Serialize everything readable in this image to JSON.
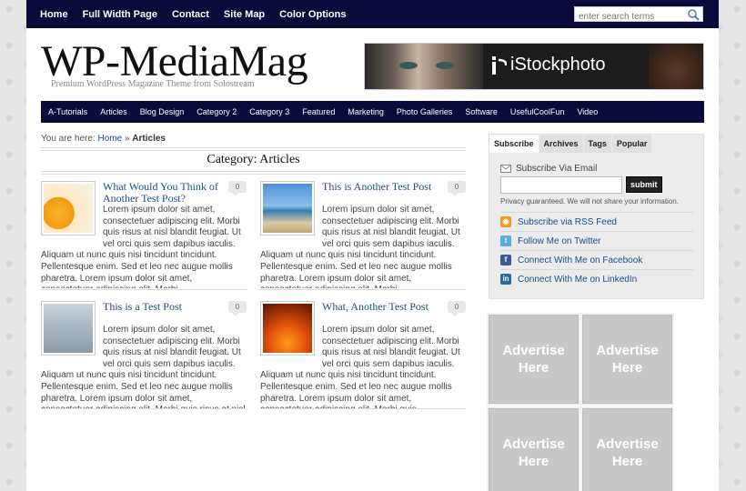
{
  "topnav": {
    "links": [
      "Home",
      "Full Width Page",
      "Contact",
      "Site Map",
      "Color Options"
    ],
    "search_placeholder": "enter search terms"
  },
  "header": {
    "logo": "WP-MediaMag",
    "tagline": "Premium WordPress Magazine Theme from Solostream",
    "banner_brand": "iStockphoto"
  },
  "catnav": [
    "A-Tutorials",
    "Articles",
    "Blog Design",
    "Category 2",
    "Category 3",
    "Featured",
    "Marketing",
    "Photo Galleries",
    "Software",
    "UsefulCoolFun",
    "Video"
  ],
  "breadcrumb": {
    "prefix": "You are here:",
    "home": "Home",
    "sep": "»",
    "current": "Articles"
  },
  "category_title": "Category: Articles",
  "posts": [
    {
      "title": "What Would You Think of Another Test Post?",
      "comments": "0",
      "excerpt": "Lorem ipsum dolor sit amet, consectetuer adipiscing elit. Morbi quis risus at nisl blandit feugiat. Ut vel orci quis sem dapibus iaculis. Aliquam ut nunc quis nisi tincidunt tincidunt. Pellentesque enim. Sed et leo nec augue mollis pharetra. Lorem ipsum dolor sit amet, consectetuer adipiscing elit. Morbi"
    },
    {
      "title": "This is Another Test Post",
      "comments": "0",
      "excerpt": "Lorem ipsum dolor sit amet, consectetuer adipiscing elit. Morbi quis risus at nisl blandit feugiat. Ut vel orci quis sem dapibus iaculis. Aliquam ut nunc quis nisi tincidunt tincidunt. Pellentesque enim. Sed et leo nec augue mollis pharetra. Lorem ipsum dolor sit amet, consectetuer adipiscing elit. Morbi"
    },
    {
      "title": "This is a Test Post",
      "comments": "0",
      "excerpt": "Lorem ipsum dolor sit amet, consectetuer adipiscing elit. Morbi quis risus at nisl blandit feugiat. Ut vel orci quis sem dapibus iaculis. Aliquam ut nunc quis nisi tincidunt tincidunt. Pellentesque enim. Sed et leo nec augue mollis pharetra. Lorem ipsum dolor sit amet, consectetuer adipiscing elit. Morbi quis risus at nisl blandit"
    },
    {
      "title": "What, Another Test Post",
      "comments": "0",
      "excerpt": "Lorem ipsum dolor sit amet, consectetuer adipiscing elit. Morbi quis risus at nisl blandit feugiat. Ut vel orci quis sem dapibus iaculis. Aliquam ut nunc quis nisi tincidunt tincidunt. Pellentesque enim. Sed et leo nec augue mollis pharetra. Lorem ipsum dolor sit amet, consectetuer adipiscing elit. Morbi quis"
    }
  ],
  "sidebar": {
    "tabs": [
      "Subscribe",
      "Archives",
      "Tags",
      "Popular"
    ],
    "subscribe_via": "Subscribe Via Email",
    "submit": "submit",
    "privacy": "Privacy guaranteed. We will not share your information.",
    "social": [
      {
        "label": "Subscribe via RSS Feed",
        "icon": "rss-icon",
        "color": "#f39a1e"
      },
      {
        "label": "Follow Me on Twitter",
        "icon": "twitter-icon",
        "color": "#4fb0e0"
      },
      {
        "label": "Connect With Me on Facebook",
        "icon": "facebook-icon",
        "color": "#3b5998"
      },
      {
        "label": "Connect With Me on LinkedIn",
        "icon": "linkedin-icon",
        "color": "#2a6aa0"
      }
    ],
    "ads": [
      "Advertise Here",
      "Advertise Here",
      "Advertise Here",
      "Advertise Here"
    ]
  },
  "colors": {
    "nav_bg": "#0a0a3a",
    "link": "#1d4e89",
    "ad_bg": "#c8c8c8"
  }
}
